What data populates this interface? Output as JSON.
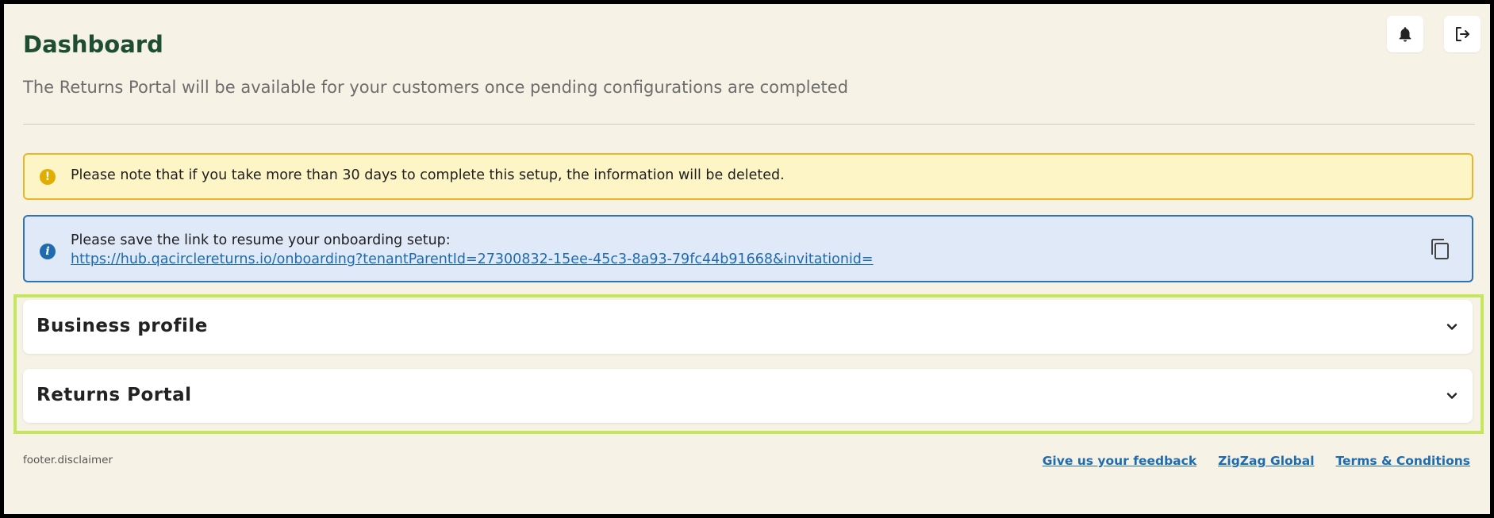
{
  "header": {
    "title": "Dashboard",
    "subtitle": "The Returns Portal will be available for your customers once pending configurations are completed",
    "icons": [
      "bell-icon",
      "logout-icon"
    ]
  },
  "alerts": {
    "warning": {
      "icon": "warning-icon",
      "text": "Please note that if you take more than 30 days to complete this setup, the information will be deleted."
    },
    "info": {
      "icon": "info-icon",
      "text": "Please save the link to resume your onboarding setup:",
      "link": "https://hub.qacirclereturns.io/onboarding?tenantParentId=27300832-15ee-45c3-8a93-79fc44b91668&invitationid=",
      "copy_icon": "copy-icon"
    }
  },
  "sections": [
    {
      "label": "Business profile",
      "icon": "chevron-down-icon"
    },
    {
      "label": "Returns Portal",
      "icon": "chevron-down-icon"
    }
  ],
  "footer": {
    "disclaimer": "footer.disclaimer",
    "links": [
      "Give us your feedback",
      "ZigZag Global",
      "Terms & Conditions"
    ]
  },
  "colors": {
    "background": "#f7f2e6",
    "title": "#1d4d33",
    "warning_bg": "#fdf5c6",
    "warning_border": "#e7b728",
    "info_bg": "#e0e9f7",
    "info_border": "#2f73b3",
    "link": "#1f6bb0",
    "highlight": "#c5e75c"
  }
}
